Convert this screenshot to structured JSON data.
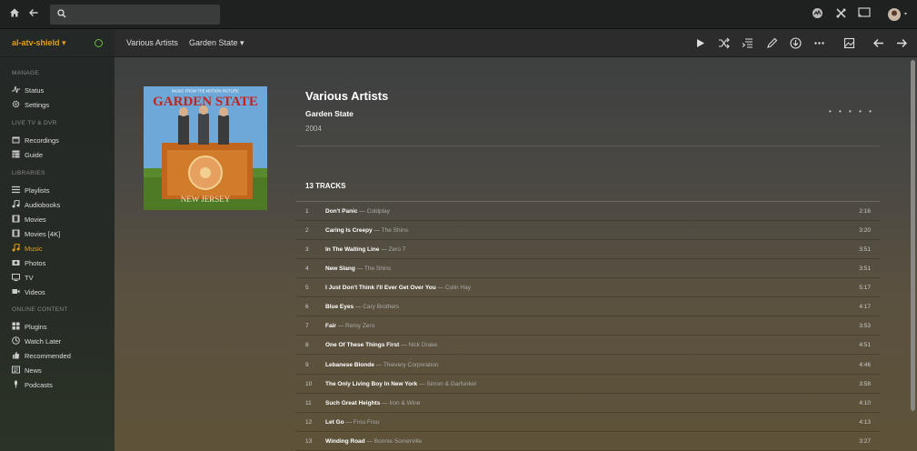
{
  "topbar": {
    "search": {
      "placeholder": ""
    }
  },
  "sidebar": {
    "server_name": "al-atv-shield ▾",
    "sections": [
      {
        "title": "MANAGE",
        "items": [
          {
            "label": "Status",
            "icon": "pulse-icon"
          },
          {
            "label": "Settings",
            "icon": "gear-icon"
          }
        ]
      },
      {
        "title": "LIVE TV & DVR",
        "items": [
          {
            "label": "Recordings",
            "icon": "calendar-icon"
          },
          {
            "label": "Guide",
            "icon": "grid-icon"
          }
        ]
      },
      {
        "title": "LIBRARIES",
        "items": [
          {
            "label": "Playlists",
            "icon": "list-icon"
          },
          {
            "label": "Audiobooks",
            "icon": "music-note-icon"
          },
          {
            "label": "Movies",
            "icon": "film-icon"
          },
          {
            "label": "Movies [4K]",
            "icon": "film-icon"
          },
          {
            "label": "Music",
            "icon": "music-note-icon",
            "active": true
          },
          {
            "label": "Photos",
            "icon": "camera-icon"
          },
          {
            "label": "TV",
            "icon": "tv-icon"
          },
          {
            "label": "Videos",
            "icon": "video-icon"
          }
        ]
      },
      {
        "title": "ONLINE CONTENT",
        "items": [
          {
            "label": "Plugins",
            "icon": "puzzle-icon"
          },
          {
            "label": "Watch Later",
            "icon": "clock-icon"
          },
          {
            "label": "Recommended",
            "icon": "thumbs-up-icon"
          },
          {
            "label": "News",
            "icon": "newspaper-icon"
          },
          {
            "label": "Podcasts",
            "icon": "microphone-icon"
          }
        ]
      }
    ]
  },
  "breadcrumb": {
    "artist": "Various Artists",
    "album": "Garden State ▾"
  },
  "album": {
    "artist": "Various Artists",
    "title": "Garden State",
    "year": "2004",
    "more": "• • • • •",
    "cover_caption": "MUSIC FROM THE MOTION PICTURE",
    "cover_title": "GARDEN STATE",
    "cover_bottom": "NEW JERSEY"
  },
  "tracks_heading": "13 TRACKS",
  "tracks": [
    {
      "num": "1",
      "title": "Don't Panic",
      "artist": "Coldplay",
      "duration": "2:16"
    },
    {
      "num": "2",
      "title": "Caring Is Creepy",
      "artist": "The Shins",
      "duration": "3:20"
    },
    {
      "num": "3",
      "title": "In The Waiting Line",
      "artist": "Zero 7",
      "duration": "3:51"
    },
    {
      "num": "4",
      "title": "New Slang",
      "artist": "The Shins",
      "duration": "3:51"
    },
    {
      "num": "5",
      "title": "I Just Don't Think I'll Ever Get Over You",
      "artist": "Colin Hay",
      "duration": "5:17"
    },
    {
      "num": "6",
      "title": "Blue Eyes",
      "artist": "Cary Brothers",
      "duration": "4:17"
    },
    {
      "num": "7",
      "title": "Fair",
      "artist": "Remy Zero",
      "duration": "3:53"
    },
    {
      "num": "8",
      "title": "One Of These Things First",
      "artist": "Nick Drake",
      "duration": "4:51"
    },
    {
      "num": "9",
      "title": "Lebanese Blonde",
      "artist": "Thievery Corporation",
      "duration": "4:46"
    },
    {
      "num": "10",
      "title": "The Only Living Boy In New York",
      "artist": "Simon & Garfunkel",
      "duration": "3:58"
    },
    {
      "num": "11",
      "title": "Such Great Heights",
      "artist": "Iron & Wine",
      "duration": "4:10"
    },
    {
      "num": "12",
      "title": "Let Go",
      "artist": "Frou Frou",
      "duration": "4:13"
    },
    {
      "num": "13",
      "title": "Winding Road",
      "artist": "Bonnie Somerville",
      "duration": "3:27"
    }
  ],
  "colors": {
    "accent": "#e5a00d",
    "status_ok": "#6bbf3a"
  }
}
